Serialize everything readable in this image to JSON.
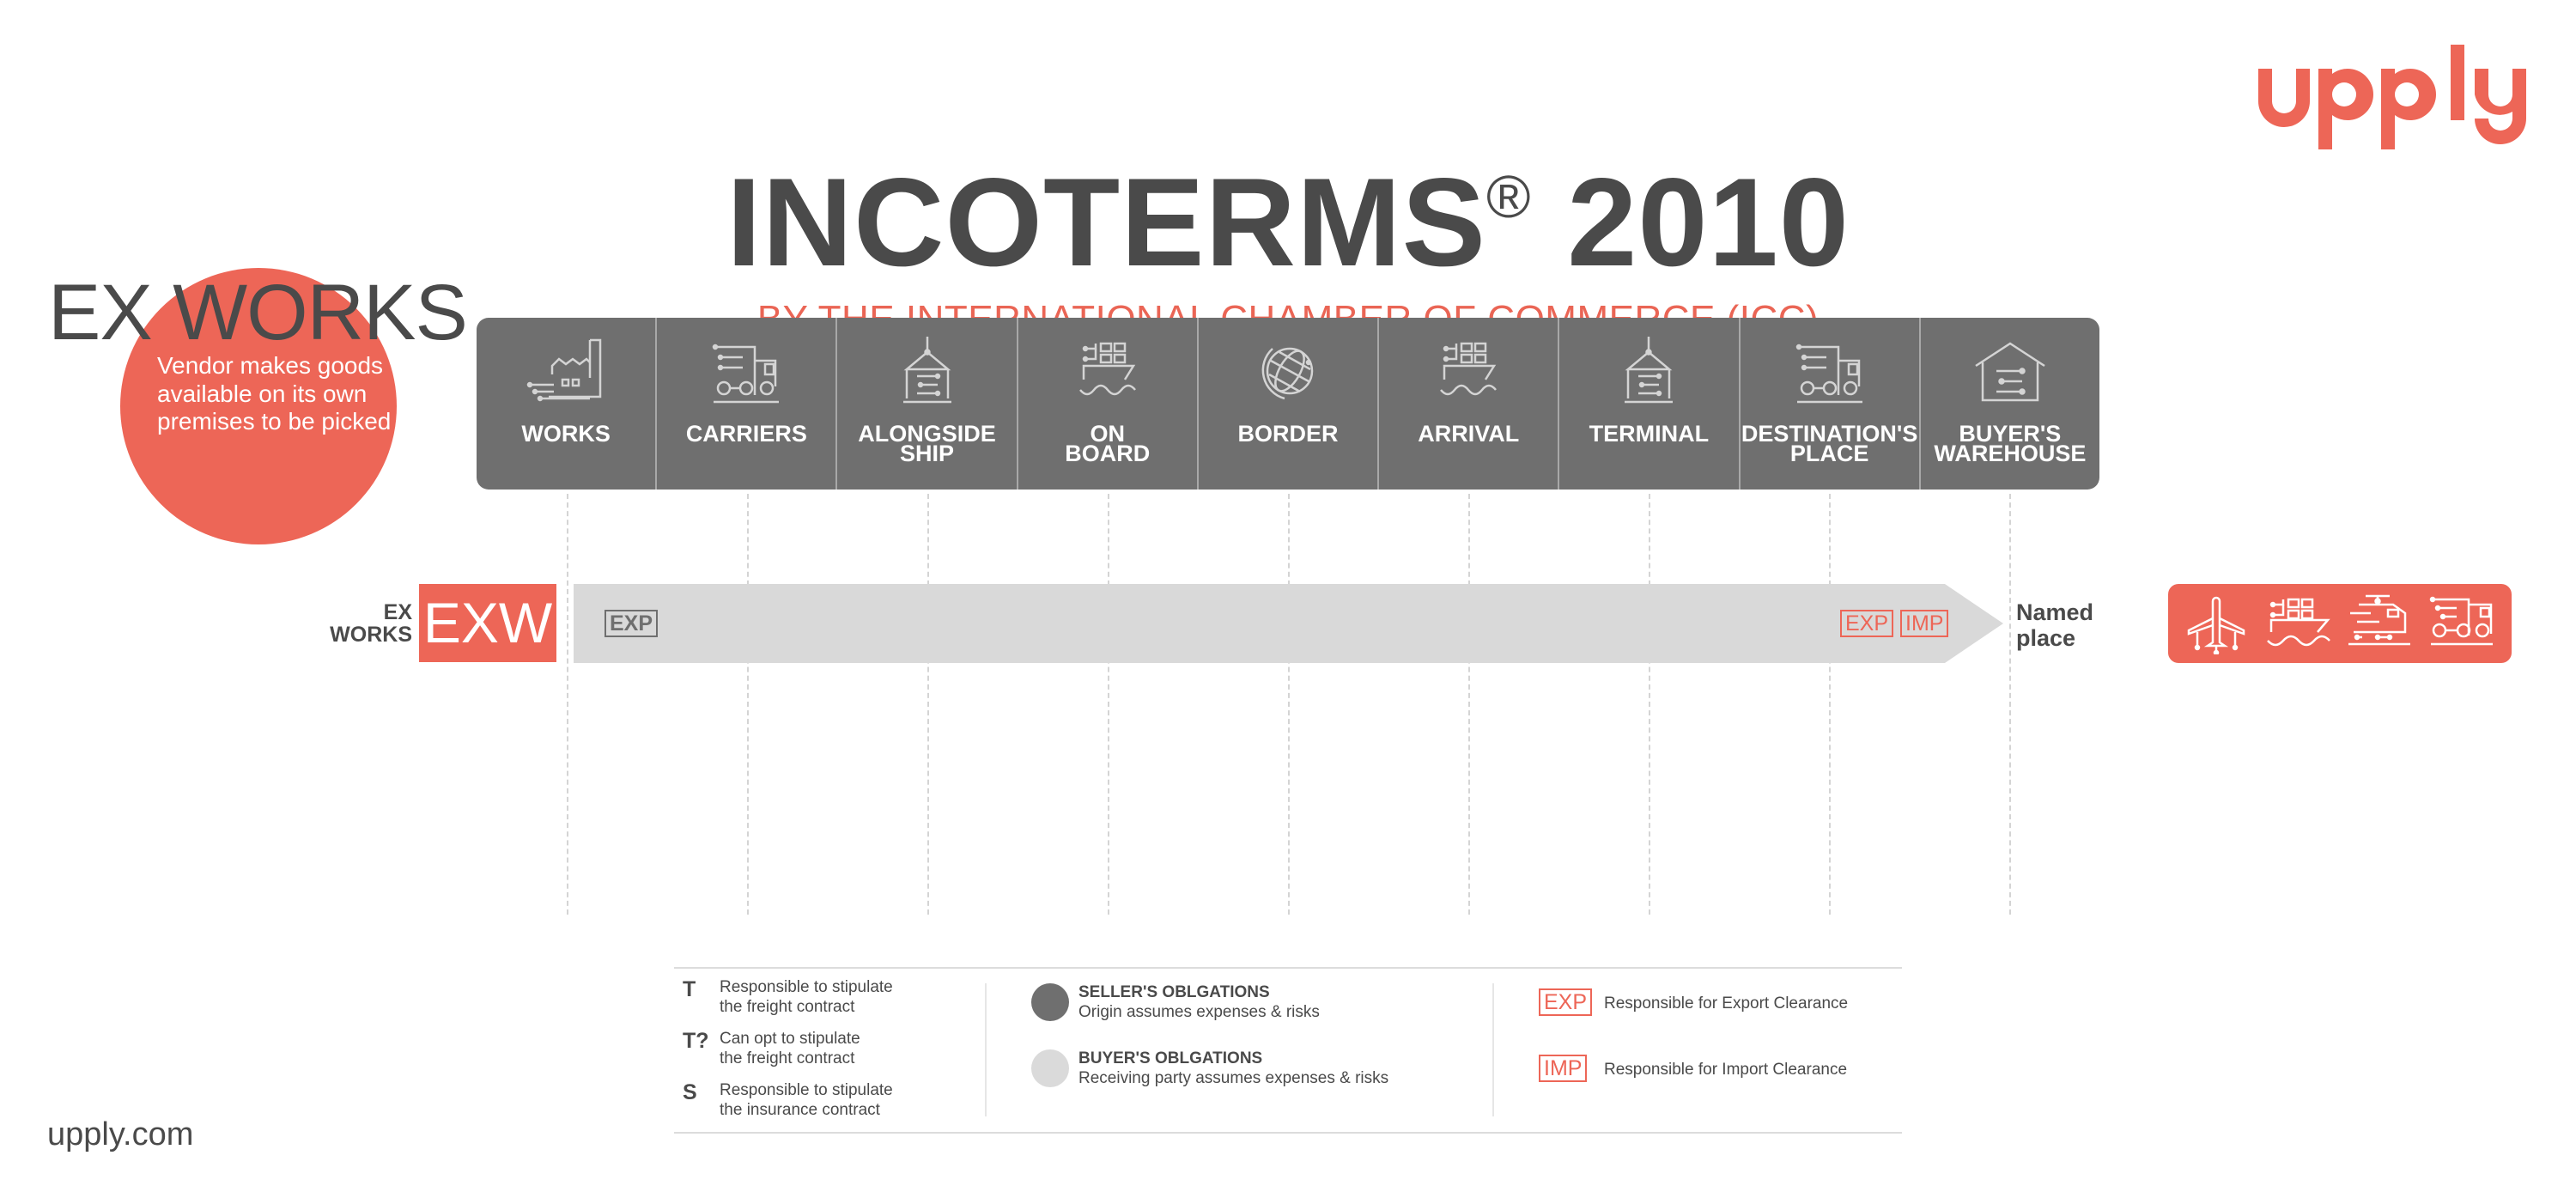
{
  "brand": {
    "logo_text": "upply",
    "url": "upply.com",
    "accent_color": "#ed6657",
    "dark_color": "#4a4a4a",
    "band_color": "#6f6f6f",
    "bar_color": "#d9d9d9"
  },
  "header": {
    "title": "INCOTERMS",
    "title_mark": "®",
    "title_year": "2010",
    "subtitle": "BY THE INTERNATIONAL CHAMBER OF COMMERCE (ICC)"
  },
  "hero": {
    "title": "EX WORKS",
    "description": "Vendor makes goods available on its own premises to be picked"
  },
  "stages": [
    {
      "label": "WORKS",
      "icon": "factory-icon"
    },
    {
      "label": "CARRIERS",
      "icon": "truck-icon"
    },
    {
      "label": "ALONGSIDE SHIP",
      "icon": "container-crane-icon"
    },
    {
      "label": "ON BOARD",
      "icon": "cargo-ship-icon"
    },
    {
      "label": "BORDER",
      "icon": "globe-icon"
    },
    {
      "label": "ARRIVAL",
      "icon": "cargo-ship-icon"
    },
    {
      "label": "TERMINAL",
      "icon": "container-crane-icon"
    },
    {
      "label": "DESTINATION'S PLACE",
      "icon": "truck-icon"
    },
    {
      "label": "BUYER'S WAREHOUSE",
      "icon": "warehouse-icon"
    }
  ],
  "term": {
    "side_label_line1": "EX",
    "side_label_line2": "WORKS",
    "code": "EXW",
    "seller_tags": [
      "EXP"
    ],
    "buyer_tags": [
      "EXP",
      "IMP"
    ],
    "named_line1": "Named",
    "named_line2": "place",
    "transport_modes": [
      "airplane-icon",
      "cargo-ship-icon",
      "train-icon",
      "truck-icon"
    ]
  },
  "legend": {
    "symbols": [
      {
        "key": "T",
        "line1": "Responsible to stipulate",
        "line2": "the freight contract"
      },
      {
        "key": "T?",
        "line1": "Can opt to stipulate",
        "line2": "the freight contract"
      },
      {
        "key": "S",
        "line1": "Responsible to stipulate",
        "line2": "the insurance contract"
      }
    ],
    "obligations": [
      {
        "title": "SELLER'S OBLGATIONS",
        "text": "Origin assumes expenses & risks",
        "color": "#6f6f6f"
      },
      {
        "title": "BUYER'S OBLGATIONS",
        "text": "Receiving party assumes expenses & risks",
        "color": "#dadada"
      }
    ],
    "clearance": [
      {
        "tag": "EXP",
        "text": "Responsible for Export Clearance"
      },
      {
        "tag": "IMP",
        "text": "Responsible for Import Clearance"
      }
    ]
  }
}
